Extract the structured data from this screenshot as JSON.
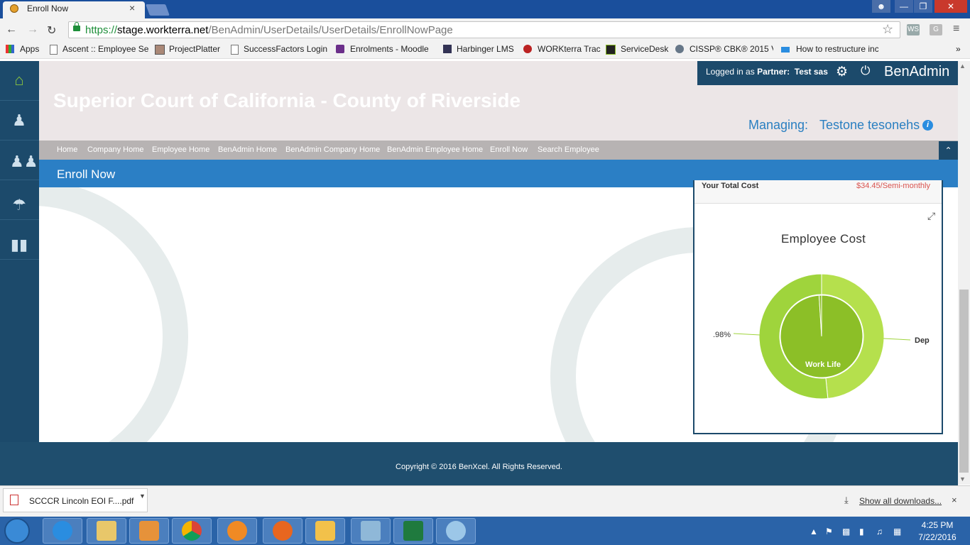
{
  "browser": {
    "tab_title": "Enroll Now",
    "tab_close": "×",
    "url_scheme": "https://",
    "url_host": "stage.workterra.net",
    "url_path": "/BenAdmin/UserDetails/UserDetails/EnrollNowPage",
    "bookmarks": [
      "Apps",
      "Ascent :: Employee Se",
      "ProjectPlatter",
      "SuccessFactors Login",
      "Enrolments - Moodle",
      "Harbinger LMS",
      "WORKterra Trac",
      "ServiceDesk",
      "CISSP® CBK® 2015 V",
      "How to restructure inc"
    ],
    "bookmarks_more": "»"
  },
  "header": {
    "company": "Superior Court of California - County of Riverside",
    "logged_in_prefix": "Logged in as",
    "logged_in_role": "Partner:",
    "logged_in_user": "Test sas",
    "app_name": "BenAdmin",
    "managing_label": "Managing:",
    "managing_name": "Testone tesonehs",
    "info_icon": "i"
  },
  "menu": {
    "items": [
      "Home",
      "Company Home",
      "Employee Home",
      "BenAdmin Home",
      "BenAdmin Company Home",
      "BenAdmin Employee Home",
      "Enroll Now",
      "Search Employee"
    ]
  },
  "page": {
    "title": "Enroll Now"
  },
  "cost_panel": {
    "total_label": "Your Total Cost",
    "total_value": "$34.45/Semi-monthly",
    "chart_title": "Employee Cost"
  },
  "chart_data": {
    "type": "pie",
    "title": "Employee Cost",
    "labels_visible": [
      ".98%",
      "Dep",
      "Work Life"
    ],
    "outer_ring": [
      {
        "label": "Dep",
        "value": 48.4,
        "color": "#b5e04d"
      },
      {
        "label": "",
        "value": 51.6,
        "color": "#9fd43c"
      }
    ],
    "inner_pie": [
      {
        "label": "Work Life",
        "value": 99.02,
        "color": "#8cbf27"
      },
      {
        "label": "",
        "value": 0.98,
        "color": "#8cbf27"
      }
    ],
    "outer_label_left": ".98%",
    "outer_label_right": "Dep",
    "inner_label": "Work Life"
  },
  "footer": {
    "copyright": "Copyright © 2016 BenXcel. All Rights Reserved."
  },
  "downloads": {
    "file_name": "SCCCR Lincoln EOI F....pdf",
    "show_all": "Show all downloads...",
    "close": "×"
  },
  "taskbar": {
    "time": "4:25 PM",
    "date": "7/22/2016"
  }
}
